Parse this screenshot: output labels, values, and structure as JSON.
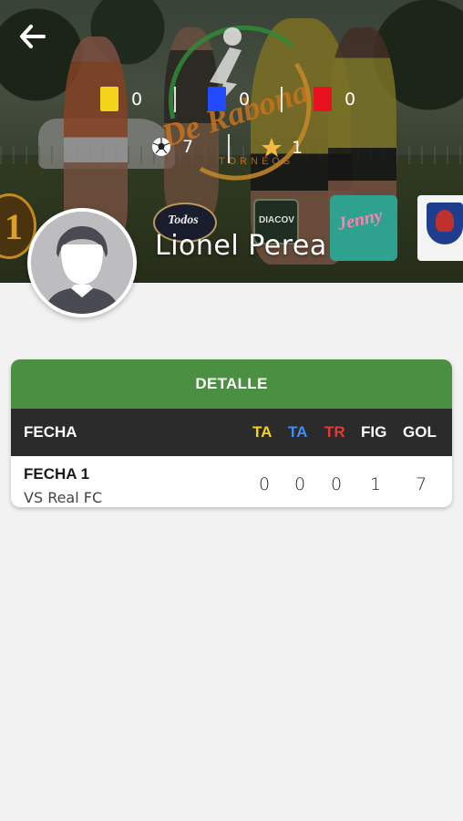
{
  "header": {
    "player_name": "Lionel Perea",
    "stats": {
      "yellow_cards": "0",
      "blue_cards": "0",
      "red_cards": "0",
      "goals": "7",
      "mvp": "1"
    },
    "colors": {
      "yellow_card": "#f3d41a",
      "blue_card": "#2149ff",
      "red_card": "#e8101e"
    },
    "icons": {
      "back": "arrow-left-icon",
      "ball": "soccer-ball-icon",
      "star": "star-icon"
    }
  },
  "detail": {
    "title": "DETALLE",
    "columns": [
      {
        "label": "FECHA",
        "color": "#ffffff"
      },
      {
        "label": "TA",
        "color": "#f3d41a"
      },
      {
        "label": "TA",
        "color": "#3f8ef0"
      },
      {
        "label": "TR",
        "color": "#e53935"
      },
      {
        "label": "FIG",
        "color": "#ffffff"
      },
      {
        "label": "GOL",
        "color": "#ffffff"
      }
    ],
    "rows": [
      {
        "fecha": "FECHA 1",
        "rival": "VS Real FC",
        "ta_yellow": "0",
        "ta_blue": "0",
        "tr": "0",
        "fig": "1",
        "gol": "7"
      }
    ],
    "header_color": "#4b8f42"
  }
}
